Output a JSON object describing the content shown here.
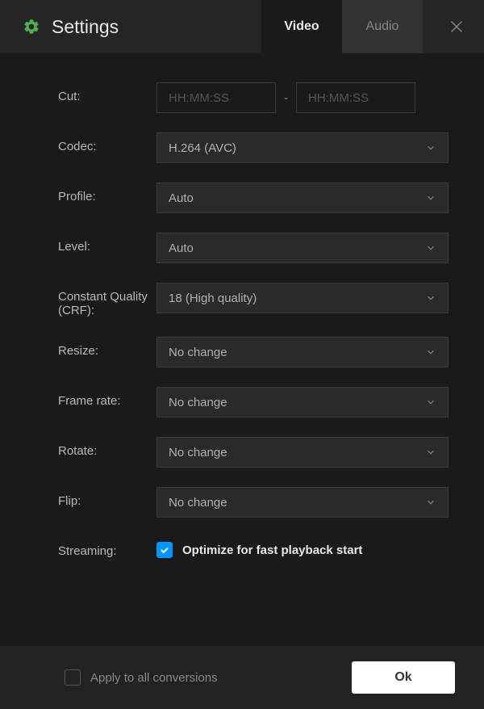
{
  "header": {
    "title": "Settings",
    "tabs": {
      "video": "Video",
      "audio": "Audio"
    }
  },
  "labels": {
    "cut": "Cut:",
    "codec": "Codec:",
    "profile": "Profile:",
    "level": "Level:",
    "crf": "Constant Quality (CRF):",
    "resize": "Resize:",
    "framerate": "Frame rate:",
    "rotate": "Rotate:",
    "flip": "Flip:",
    "streaming": "Streaming:"
  },
  "values": {
    "cut_placeholder": "HH:MM:SS",
    "cut_sep": "-",
    "codec": "H.264 (AVC)",
    "profile": "Auto",
    "level": "Auto",
    "crf": "18 (High quality)",
    "resize": "No change",
    "framerate": "No change",
    "rotate": "No change",
    "flip": "No change",
    "streaming_label": "Optimize for fast playback start"
  },
  "footer": {
    "apply_all": "Apply to all conversions",
    "ok": "Ok"
  }
}
